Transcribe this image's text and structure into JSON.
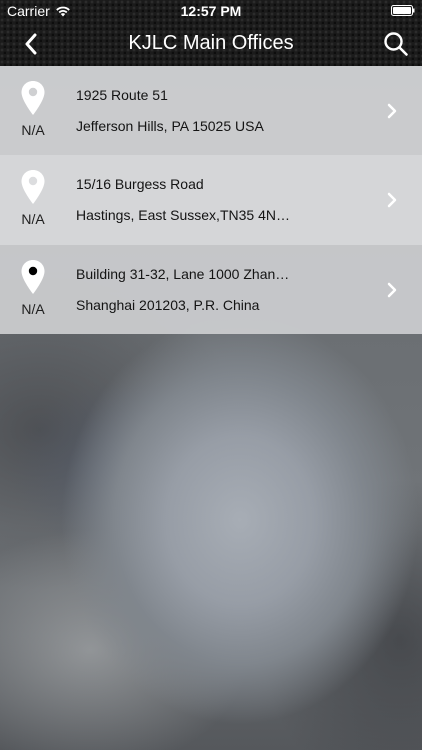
{
  "status_bar": {
    "carrier": "Carrier",
    "time": "12:57 PM"
  },
  "nav": {
    "title": "KJLC Main Offices",
    "back_icon": "chevron-left-icon",
    "search_icon": "search-icon"
  },
  "offices": [
    {
      "rating": "N/A",
      "line1": "1925 Route 51",
      "line2": "Jefferson Hills, PA 15025 USA"
    },
    {
      "rating": "N/A",
      "line1": "15/16 Burgess Road",
      "line2": "Hastings, East Sussex,TN35 4N…"
    },
    {
      "rating": "N/A",
      "line1": "Building 31-32, Lane 1000 Zhan…",
      "line2": "Shanghai 201203, P.R. China"
    }
  ],
  "colors": {
    "header": "#1b1b1b",
    "icon": "#ffffff",
    "text": "#141414"
  }
}
